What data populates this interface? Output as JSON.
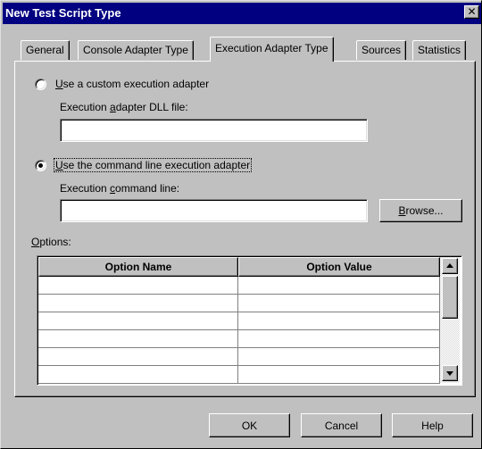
{
  "window": {
    "title": "New Test Script Type",
    "close_glyph": "✕"
  },
  "tabs": [
    {
      "label": "General",
      "active": false
    },
    {
      "label": "Console Adapter Type",
      "active": false
    },
    {
      "label": "Execution Adapter Type",
      "active": true
    },
    {
      "label": "Sources",
      "active": false
    },
    {
      "label": "Statistics",
      "active": false
    }
  ],
  "custom_adapter": {
    "radio": {
      "pre": "",
      "ul": "U",
      "post": "se a custom execution adapter",
      "selected": false
    },
    "dll_label": {
      "pre": "Execution ",
      "ul": "a",
      "post": "dapter DLL file:"
    },
    "dll_value": ""
  },
  "cmdline_adapter": {
    "radio": {
      "pre": "",
      "ul": "U",
      "post": "se the command line execution adapter",
      "selected": true
    },
    "cmd_label": {
      "pre": "Execution ",
      "ul": "c",
      "post": "ommand line:"
    },
    "cmd_value": "",
    "browse": {
      "pre": "",
      "ul": "B",
      "post": "rowse..."
    }
  },
  "options": {
    "label": {
      "pre": "",
      "ul": "O",
      "post": "ptions:"
    },
    "columns": [
      "Option Name",
      "Option Value"
    ],
    "rows": [
      [
        "",
        ""
      ],
      [
        "",
        ""
      ],
      [
        "",
        ""
      ],
      [
        "",
        ""
      ],
      [
        "",
        ""
      ],
      [
        "",
        ""
      ]
    ]
  },
  "footer": {
    "ok": "OK",
    "cancel": "Cancel",
    "help": "Help"
  }
}
